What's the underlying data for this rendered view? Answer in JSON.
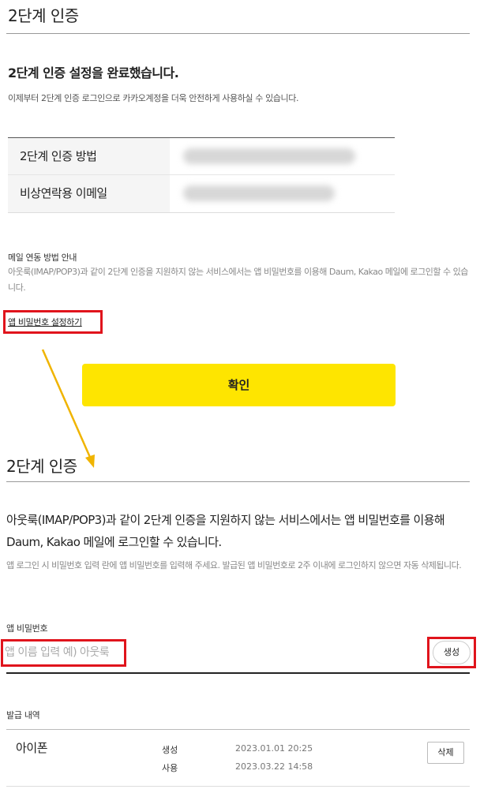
{
  "section1": {
    "title": "2단계 인증",
    "headline": "2단계 인증 설정을 완료했습니다.",
    "subline": "이제부터 2단계 인증 로그인으로 카카오계정을 더욱 안전하게 사용하실 수 있습니다.",
    "rows": [
      {
        "label": "2단계 인증 방법"
      },
      {
        "label": "비상연락용 이메일"
      }
    ],
    "mail_guide": {
      "title": "메일 연동 방법 안내",
      "body": "아웃룩(IMAP/POP3)과 같이 2단계 인증을 지원하지 않는 서비스에서는 앱 비밀번호를 이용해 Daum, Kakao 메일에 로그인할 수 있습니다."
    },
    "app_password_link": "앱 비밀번호 설정하기",
    "confirm_label": "확인"
  },
  "section2": {
    "title": "2단계 인증",
    "description": "아웃룩(IMAP/POP3)과 같이 2단계 인증을 지원하지 않는 서비스에서는 앱 비밀번호를 이용해 Daum, Kakao 메일에 로그인할 수 있습니다.",
    "note": "앱 로그인 시 비밀번호 입력 란에 앱 비밀번호를 입력해 주세요. 발급된 앱 비밀번호로 2주 이내에 로그인하지 않으면 자동 삭제됩니다.",
    "app_password_label": "앱 비밀번호",
    "input_placeholder": "앱 이름 입력 예) 아웃룩",
    "create_label": "생성",
    "history_label": "발급 내역",
    "history": [
      {
        "device": "아이폰",
        "created_label": "생성",
        "created": "2023.01.01 20:25",
        "used_label": "사용",
        "used": "2023.03.22 14:58",
        "delete_label": "삭제"
      }
    ]
  },
  "colors": {
    "highlight": "#e0141c",
    "arrow": "#f0b400",
    "confirm_button": "#fee500"
  }
}
